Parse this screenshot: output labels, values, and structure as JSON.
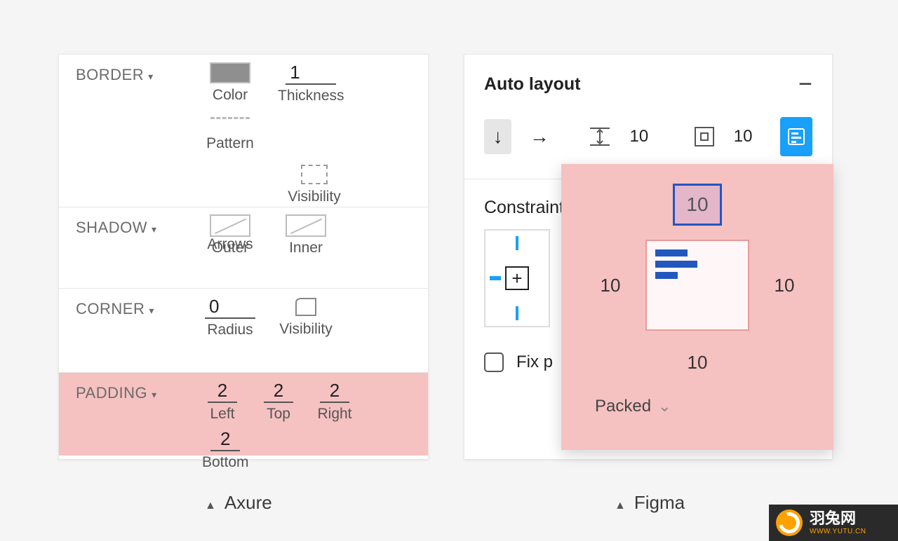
{
  "captions": {
    "axure": "Axure",
    "figma": "Figma"
  },
  "axure": {
    "sections": {
      "border": {
        "title": "BORDER",
        "color_label": "Color",
        "thickness_value": "1",
        "thickness_label": "Thickness",
        "pattern_label": "Pattern",
        "visibility_label": "Visibility",
        "arrows_label": "Arrows"
      },
      "shadow": {
        "title": "SHADOW",
        "outer_label": "Outer",
        "inner_label": "Inner"
      },
      "corner": {
        "title": "CORNER",
        "radius_value": "0",
        "radius_label": "Radius",
        "visibility_label": "Visibility"
      },
      "padding": {
        "title": "PADDING",
        "left_value": "2",
        "left_label": "Left",
        "top_value": "2",
        "top_label": "Top",
        "right_value": "2",
        "right_label": "Right",
        "bottom_value": "2",
        "bottom_label": "Bottom"
      }
    }
  },
  "figma": {
    "header": "Auto layout",
    "spacing_value": "10",
    "padding_value": "10",
    "constraints_label": "Constraints",
    "fix_label": "Fix position when scrolling",
    "fix_label_truncated": "Fix p",
    "popover": {
      "top": "10",
      "left": "10",
      "right": "10",
      "bottom": "10",
      "mode": "Packed"
    }
  },
  "watermark": {
    "name": "羽兔网",
    "url": "WWW.YUTU.CN"
  }
}
